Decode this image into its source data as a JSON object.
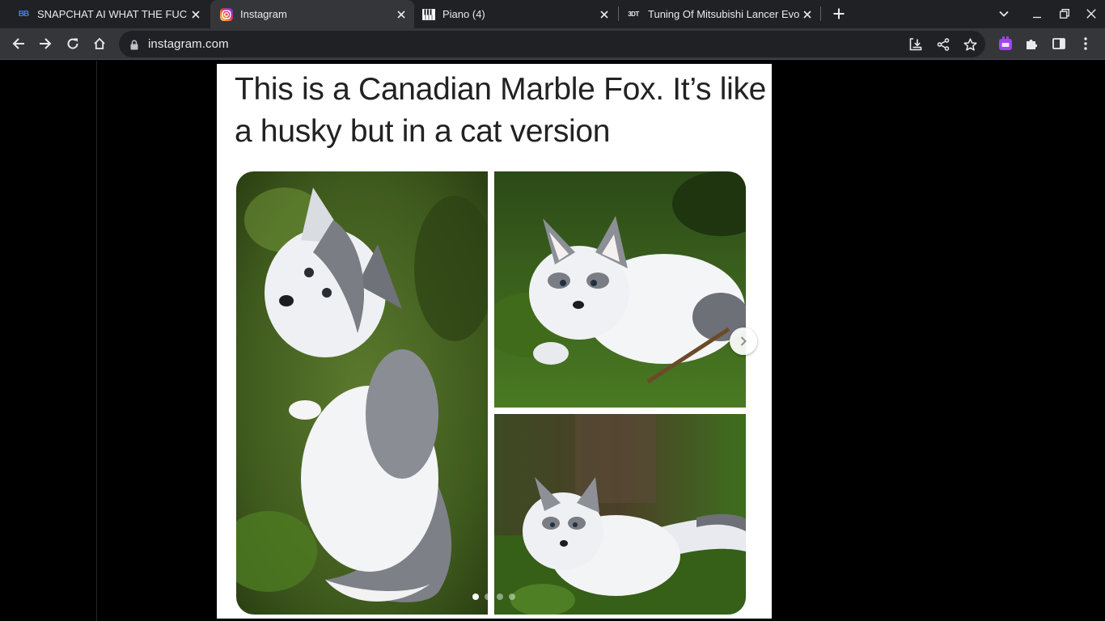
{
  "browser": {
    "tabs": [
      {
        "title": "SNAPCHAT AI WHAT THE FUCK",
        "favicon": "bb-favicon-icon",
        "active": false
      },
      {
        "title": "Instagram",
        "favicon": "instagram-icon",
        "active": true
      },
      {
        "title": "Piano (4)",
        "favicon": "piano-icon",
        "active": false
      },
      {
        "title": "Tuning Of Mitsubishi Lancer Evo",
        "favicon": "3dt-favicon-icon",
        "active": false
      }
    ],
    "favicon_text": {
      "bb": "BB",
      "tdt": "3DT"
    },
    "address": "instagram.com"
  },
  "post": {
    "caption": "This is a Canadian Marble Fox. It’s like a husky but in a cat version",
    "carousel": {
      "total_slides": 4,
      "current_slide": 1
    }
  },
  "colors": {
    "tab_strip": "#202124",
    "toolbar": "#35363a",
    "omnibox": "#202124",
    "page_bg": "#000000",
    "extension_accent": "#a142f4",
    "instagram_gradient": [
      "#feda75",
      "#fa7e1e",
      "#d62976",
      "#962fbf",
      "#4f5bd5"
    ]
  }
}
